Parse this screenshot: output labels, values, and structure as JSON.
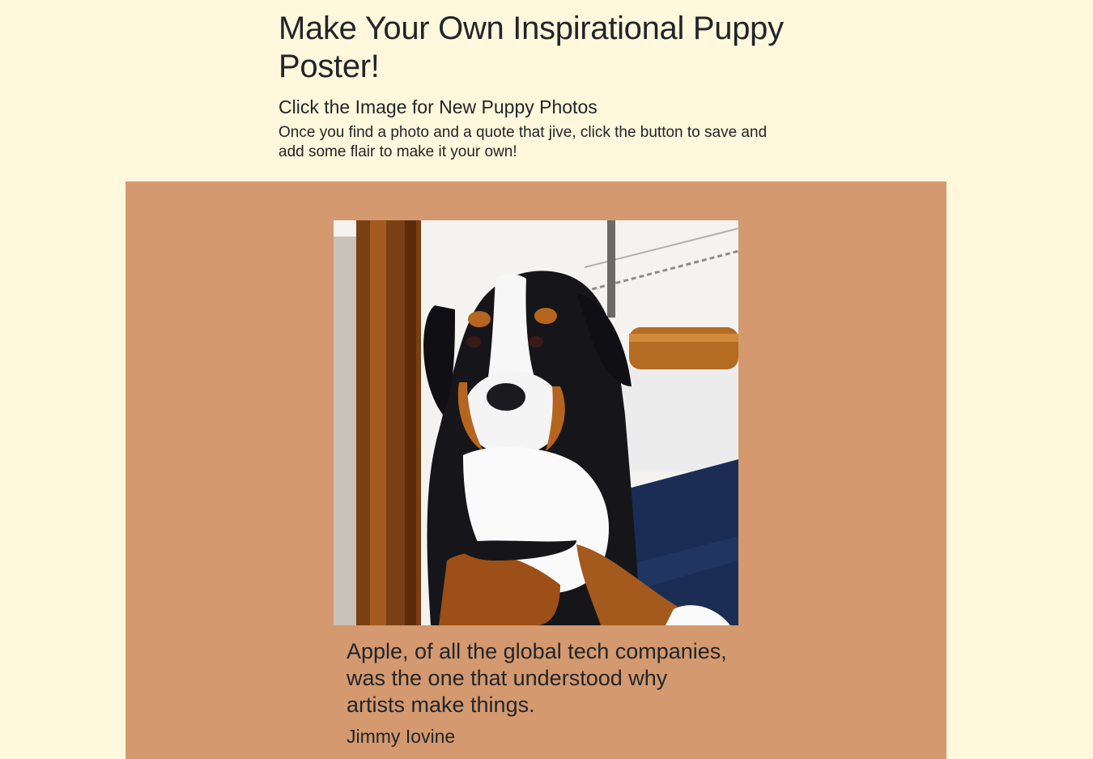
{
  "header": {
    "title": "Make Your Own Inspirational Puppy Poster!",
    "subtitle": "Click the Image for New Puppy Photos",
    "instructions": "Once you find a photo and a quote that jive, click the button to save and add some flair to make it your own!"
  },
  "poster": {
    "background_color": "#d4996e",
    "photo": {
      "icon": "puppy-photo",
      "description_hidden": true
    },
    "quote_text": "Apple, of all the global tech companies, was the one that understood why artists make things.",
    "quote_author": "Jimmy Iovine"
  },
  "colors": {
    "page_background": "#fff8dc",
    "text": "#212529"
  }
}
